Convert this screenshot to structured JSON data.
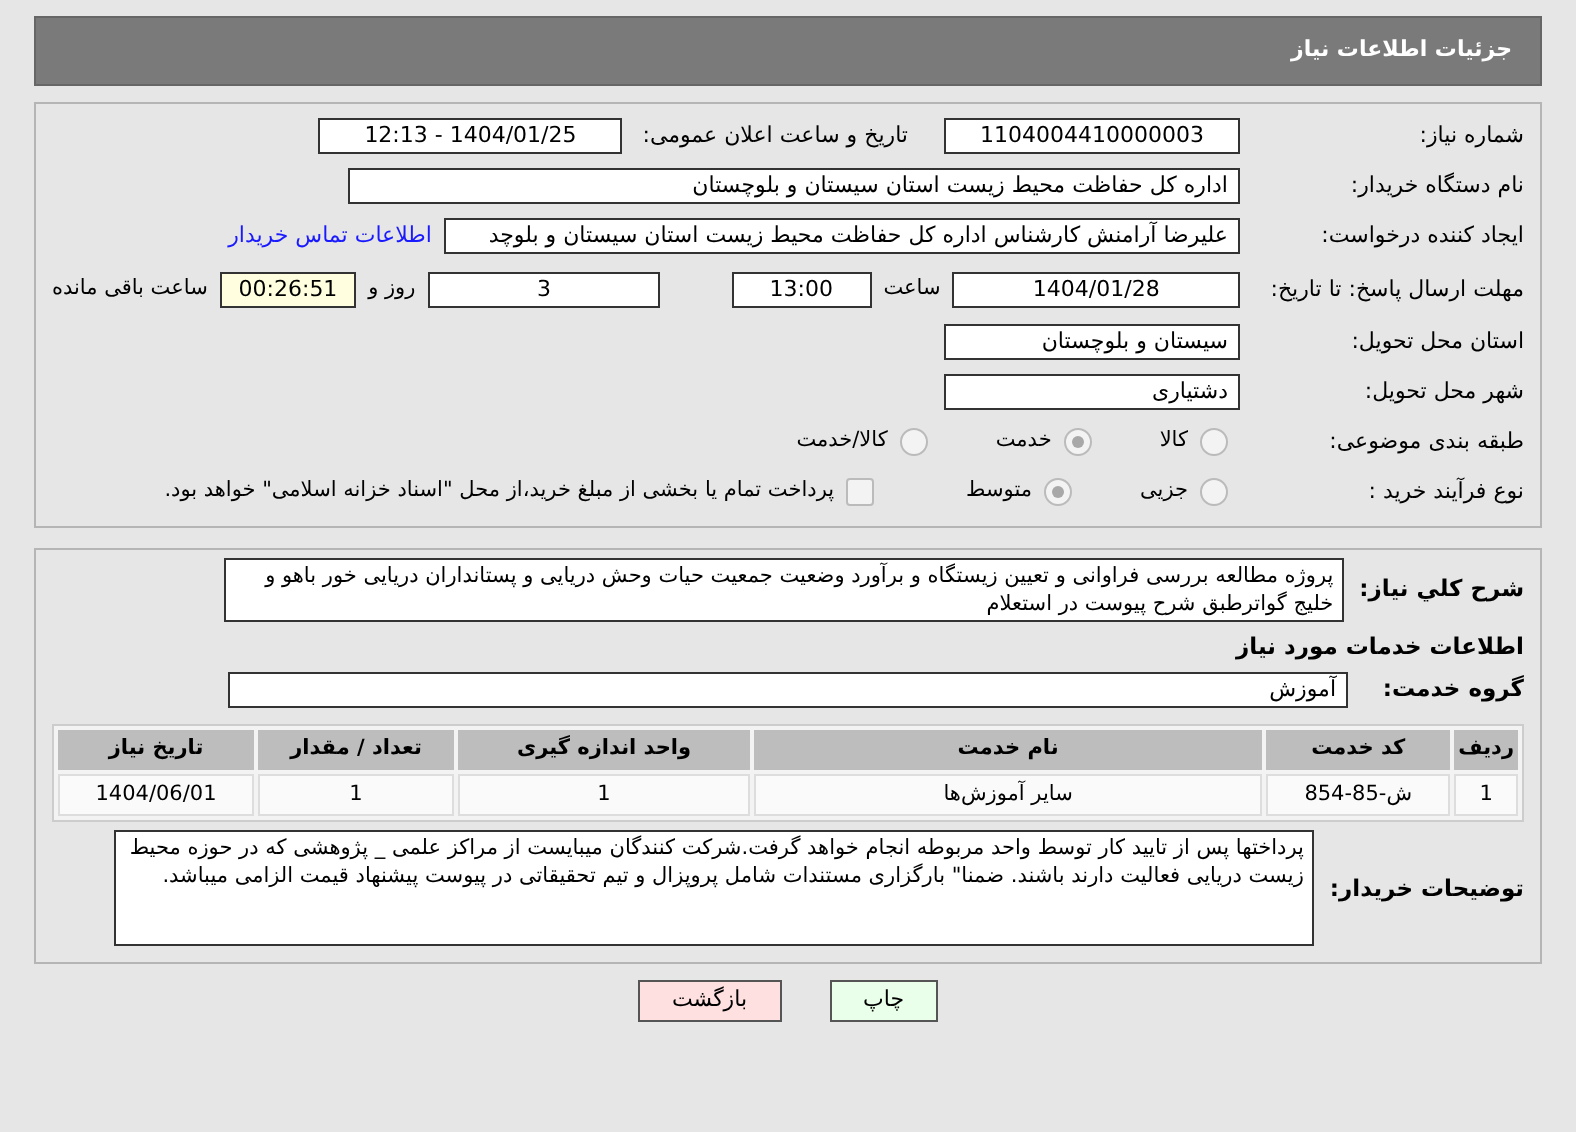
{
  "header": {
    "title": "جزئیات اطلاعات نیاز"
  },
  "need_number": {
    "label": "شماره نیاز:",
    "value": "1104004410000003"
  },
  "announce": {
    "label": "تاریخ و ساعت اعلان عمومی:",
    "value": "1404/01/25 - 12:13"
  },
  "buyer_org": {
    "label": "نام دستگاه خریدار:",
    "value": "اداره کل حفاظت محیط زیست استان سیستان و بلوچستان"
  },
  "requester": {
    "label": "ایجاد کننده درخواست:",
    "value": "علیرضا آرامنش کارشناس اداره کل حفاظت محیط زیست استان سیستان و بلوچد",
    "link": "اطلاعات تماس خریدار"
  },
  "deadline": {
    "label": "مهلت ارسال پاسخ: تا تاریخ:",
    "date": "1404/01/28",
    "time_label": "ساعت",
    "time": "13:00",
    "days": "3",
    "days_label": "روز و",
    "remaining": "00:26:51",
    "remaining_label": "ساعت باقی مانده"
  },
  "province": {
    "label": "استان محل تحویل:",
    "value": "سیستان و بلوچستان"
  },
  "city": {
    "label": "شهر محل تحویل:",
    "value": "دشتیاری"
  },
  "category": {
    "label": "طبقه بندی موضوعی:",
    "options": [
      {
        "label": "کالا",
        "selected": false
      },
      {
        "label": "خدمت",
        "selected": true
      },
      {
        "label": "کالا/خدمت",
        "selected": false
      }
    ]
  },
  "process": {
    "label": "نوع فرآیند خرید :",
    "options": [
      {
        "label": "جزیی",
        "selected": false
      },
      {
        "label": "متوسط",
        "selected": true
      }
    ],
    "checkbox": {
      "label": "پرداخت تمام یا بخشی از مبلغ خرید،از محل \"اسناد خزانه اسلامی\" خواهد بود.",
      "checked": false
    }
  },
  "description": {
    "label": "شرح کلي نياز:",
    "value": "پروژه مطالعه بررسی فراوانی و تعیین زیستگاه و برآورد وضعیت جمعیت حیات وحش دریایی و پستانداران دریایی خور باهو و خلیج گواترطبق شرح پیوست در استعلام"
  },
  "services_title": "اطلاعات خدمات مورد نیاز",
  "service_group": {
    "label": "گروه خدمت:",
    "value": "آموزش"
  },
  "table": {
    "columns": [
      "ردیف",
      "کد خدمت",
      "نام خدمت",
      "واحد اندازه گیری",
      "تعداد / مقدار",
      "تاریخ نیاز"
    ],
    "rows": [
      [
        "1",
        "ش-85-854",
        "سایر آموزش‌ها",
        "1",
        "1",
        "1404/06/01"
      ]
    ]
  },
  "buyer_notes": {
    "label": "توضیحات خریدار:",
    "value": "پرداختها پس از تایید کار توسط واحد مربوطه انجام خواهد گرفت.شرکت کنندگان میبایست از مراکز علمی _ پژوهشی که در حوزه محیط زیست دریایی فعالیت دارند باشند. ضمنا\" بارگزاری مستندات شامل پروپزال و تیم تحقیقاتی در پیوست پیشنهاد قیمت الزامی میباشد."
  },
  "buttons": [
    {
      "label": "چاپ",
      "kind": "print"
    },
    {
      "label": "بازگشت",
      "kind": "back"
    }
  ]
}
